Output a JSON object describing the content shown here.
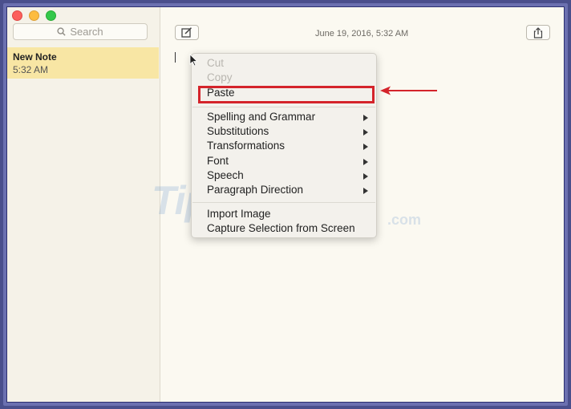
{
  "sidebar": {
    "search_placeholder": "Search",
    "notes": [
      {
        "title": "New Note",
        "time": "5:32 AM"
      }
    ]
  },
  "editor": {
    "date": "June 19, 2016, 5:32 AM"
  },
  "context_menu": {
    "items": [
      {
        "label": "Cut",
        "enabled": false
      },
      {
        "label": "Copy",
        "enabled": false
      },
      {
        "label": "Paste",
        "enabled": true,
        "highlighted": true
      },
      {
        "label": "Spelling and Grammar",
        "submenu": true
      },
      {
        "label": "Substitutions",
        "submenu": true
      },
      {
        "label": "Transformations",
        "submenu": true
      },
      {
        "label": "Font",
        "submenu": true
      },
      {
        "label": "Speech",
        "submenu": true
      },
      {
        "label": "Paragraph Direction",
        "submenu": true
      },
      {
        "label": "Import Image"
      },
      {
        "label": "Capture Selection from Screen"
      }
    ]
  },
  "watermark": {
    "text": "TipsMake",
    "suffix": ".com"
  },
  "colors": {
    "highlight_box": "#d4242b",
    "selected_note": "#f8e6a4",
    "background": "#fbf9f1"
  },
  "icons": [
    "search-icon",
    "compose-icon",
    "share-icon",
    "submenu-arrow-icon",
    "mouse-pointer-icon",
    "red-arrow-icon"
  ]
}
